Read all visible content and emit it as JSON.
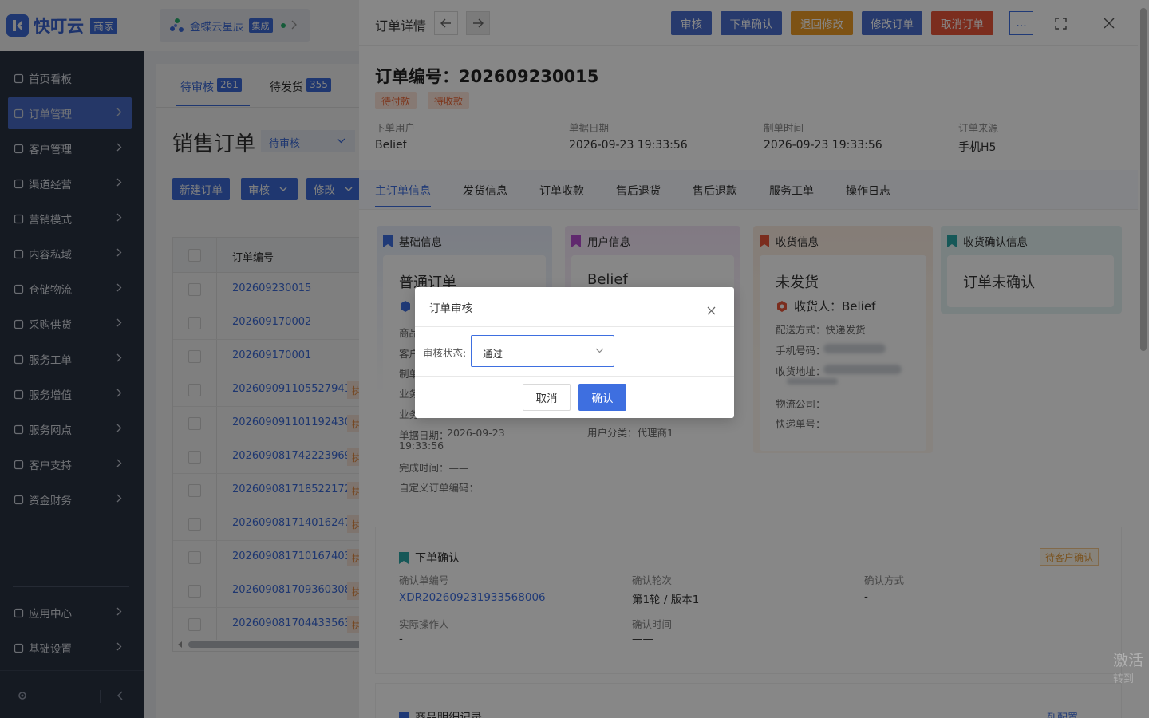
{
  "brand": {
    "name": "快叮云",
    "badge": "商家",
    "accent": "#3e6fe0"
  },
  "tenant": {
    "name": "金蝶云星辰",
    "badge": "集成"
  },
  "sidebar": {
    "items": [
      {
        "label": "首页看板",
        "icon": "home-icon"
      },
      {
        "label": "订单管理",
        "icon": "order-icon",
        "active": true
      },
      {
        "label": "客户管理",
        "icon": "user-icon"
      },
      {
        "label": "渠道经营",
        "icon": "channel-icon"
      },
      {
        "label": "营销模式",
        "icon": "tag-icon"
      },
      {
        "label": "内容私域",
        "icon": "mail-icon"
      },
      {
        "label": "仓储物流",
        "icon": "warehouse-icon"
      },
      {
        "label": "采购供货",
        "icon": "purchase-icon"
      },
      {
        "label": "服务工单",
        "icon": "ticket-icon"
      },
      {
        "label": "服务增值",
        "icon": "bag-icon"
      },
      {
        "label": "服务网点",
        "icon": "store-icon"
      },
      {
        "label": "客户支持",
        "icon": "support-icon"
      },
      {
        "label": "资金财务",
        "icon": "yen-icon"
      }
    ],
    "bottom": [
      {
        "label": "应用中心",
        "icon": "cube-icon"
      },
      {
        "label": "基础设置",
        "icon": "settings-icon"
      }
    ]
  },
  "list": {
    "tabs": [
      {
        "label": "待审核",
        "count": "261"
      },
      {
        "label": "待发货",
        "count": "355"
      }
    ],
    "title": "销售订单",
    "status_filter": "待审核",
    "actions": {
      "new": "新建订单",
      "review": "审核",
      "modify": "修改"
    },
    "column_header": "订单编号",
    "rows": [
      "202609230015",
      "202609170002",
      "202609170001",
      "202609091105527941",
      "202609091101192430",
      "202609081742223969",
      "202609081718522172",
      "202609081714016247",
      "202609081710167403",
      "202609081709360308",
      "202609081704433563"
    ],
    "row_tag": "执"
  },
  "drawer": {
    "title": "订单详情",
    "buttons": {
      "review": "审核",
      "order_confirm": "下单确认",
      "return_modify": "退回修改",
      "modify_order": "修改订单",
      "cancel_order": "取消订单",
      "more": "..."
    },
    "colors": {
      "blue": "#4a6fcf",
      "orange": "#ec9b27",
      "red": "#e8553a"
    },
    "order_no": "订单编号：202609230015",
    "pills": [
      "待付款",
      "待收款"
    ],
    "meta": [
      {
        "label": "下单用户",
        "value": "Belief"
      },
      {
        "label": "单据日期",
        "value": "2026-09-23 19:33:56"
      },
      {
        "label": "制单时间",
        "value": "2026-09-23 19:33:56"
      },
      {
        "label": "订单来源",
        "value": "手机H5"
      }
    ],
    "tabs": [
      "主订单信息",
      "发货信息",
      "订单收款",
      "售后退货",
      "售后退款",
      "服务工单",
      "操作日志"
    ],
    "cards": {
      "basic": {
        "title": "基础信息",
        "type": "普通订单",
        "labels": [
          "商品",
          "客户",
          "制单",
          "业务",
          "业务"
        ],
        "doc_date_label": "单据日期：",
        "doc_date_value": "2026-09-23",
        "doc_time": "19:33:56",
        "finish_time": "完成时间：——",
        "custom_code": "自定义订单编码："
      },
      "user": {
        "title": "用户信息",
        "name": "Belief",
        "category": "用户分类：代理商1"
      },
      "receipt": {
        "title": "收货信息",
        "status": "未发货",
        "receiver": "收货人：Belief",
        "delivery": "配送方式：快递发货",
        "phone": "手机号码：",
        "address": "收货地址：",
        "logistics": "物流公司：",
        "express_no": "快递单号："
      },
      "confirm": {
        "title": "收货确认信息",
        "status": "订单未确认"
      }
    },
    "order_confirmation": {
      "title": "下单确认",
      "status": "待客户确认",
      "confirm_no_label": "确认单编号",
      "confirm_no": "XDR202609231933568006",
      "round_label": "确认轮次",
      "round": "第1轮 / 版本1",
      "method_label": "确认方式",
      "method": "-",
      "operator_label": "实际操作人",
      "operator": "-",
      "time_label": "确认时间",
      "time": "——"
    },
    "next_section": "商品明细记录",
    "column_config": "列配置"
  },
  "modal": {
    "title": "订单审核",
    "field_label": "审核状态:",
    "value": "通过",
    "cancel": "取消",
    "ok": "确认"
  },
  "watermark": {
    "line1": "激活",
    "line2": "转到"
  }
}
